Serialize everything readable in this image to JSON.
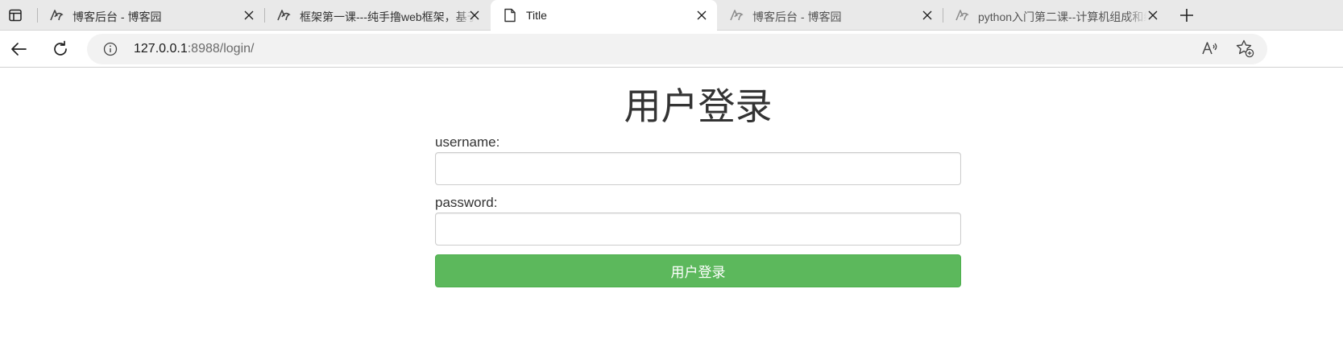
{
  "browser": {
    "tabs": [
      {
        "title": "博客后台 - 博客园",
        "icon": "cnblogs-icon",
        "state": "inactive"
      },
      {
        "title": "框架第一课---纯手撸web框架，基于wsgiref模块",
        "icon": "cnblogs-icon",
        "state": "inactive"
      },
      {
        "title": "Title",
        "icon": "page-icon",
        "state": "active"
      },
      {
        "title": "博客后台 - 博客园",
        "icon": "cnblogs-icon",
        "state": "faded"
      },
      {
        "title": "python入门第二课--计算机组成和编程语言",
        "icon": "cnblogs-icon",
        "state": "faded"
      }
    ],
    "new_tab_icon": "plus-icon",
    "address": {
      "host": "127.0.0.1",
      "rest": ":8988/login/"
    }
  },
  "page": {
    "heading": "用户登录",
    "username_label": "username:",
    "username_value": "",
    "password_label": "password:",
    "password_value": "",
    "submit_label": "用户登录"
  },
  "colors": {
    "submit_button": "#5cb85c",
    "tabstrip": "#e9e9e9",
    "address_bar": "#f2f2f2"
  }
}
